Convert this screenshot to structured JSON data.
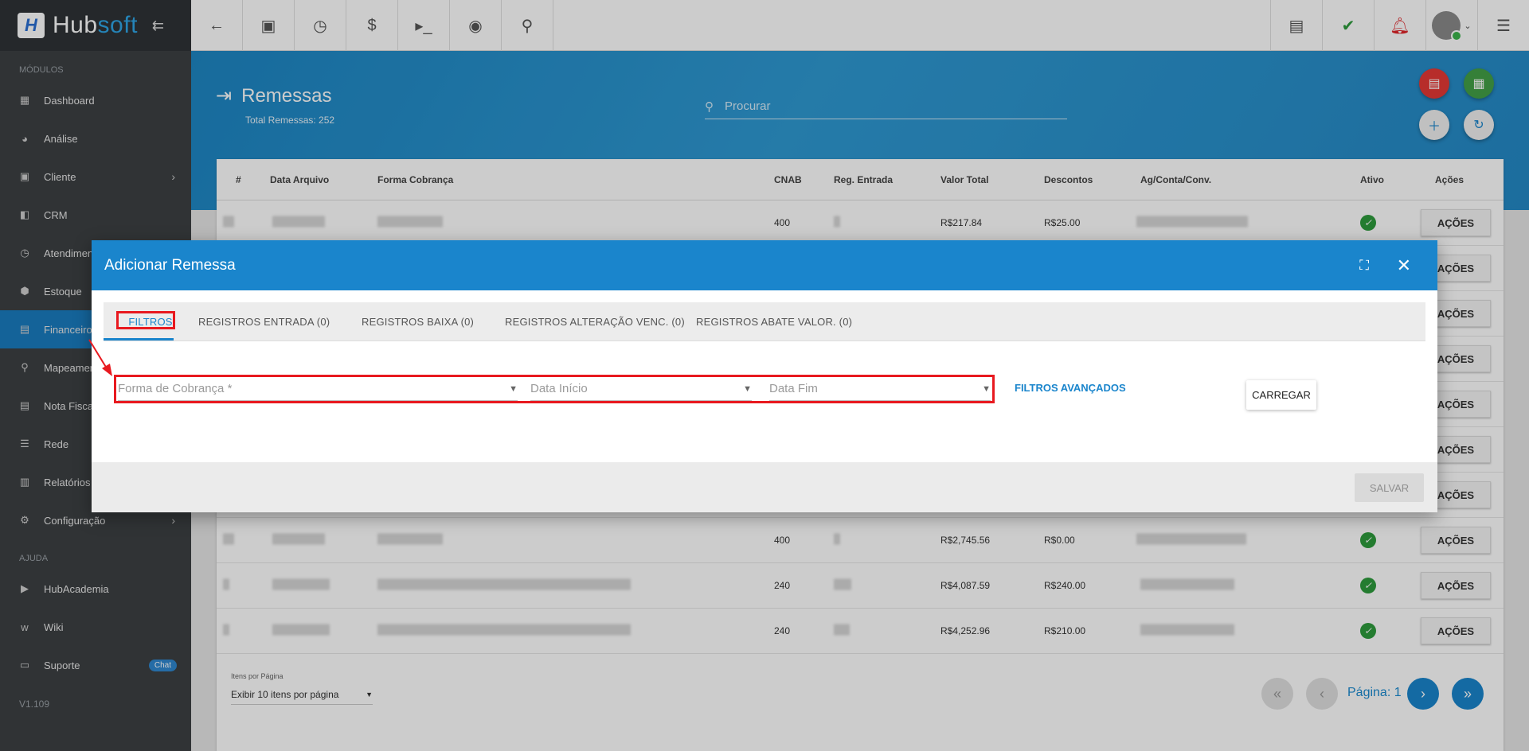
{
  "brand": {
    "hub": "Hub",
    "soft": "soft"
  },
  "sidebar": {
    "section_modules": "MÓDULOS",
    "section_help": "AJUDA",
    "items": [
      {
        "label": "Dashboard",
        "icon": "dashboard-icon"
      },
      {
        "label": "Análise",
        "icon": "pie-chart-icon"
      },
      {
        "label": "Cliente",
        "icon": "contact-card-icon",
        "has_children": true
      },
      {
        "label": "CRM",
        "icon": "crm-icon"
      },
      {
        "label": "Atendimentos",
        "icon": "clock-icon"
      },
      {
        "label": "Estoque",
        "icon": "box-icon"
      },
      {
        "label": "Financeiro",
        "icon": "money-icon",
        "active": true
      },
      {
        "label": "Mapeamento",
        "icon": "map-pin-icon"
      },
      {
        "label": "Nota Fiscal",
        "icon": "invoice-icon"
      },
      {
        "label": "Rede",
        "icon": "network-icon"
      },
      {
        "label": "Relatórios",
        "icon": "report-icon"
      },
      {
        "label": "Configuração",
        "icon": "gear-icon",
        "has_children": true
      }
    ],
    "help_items": [
      {
        "label": "HubAcademia",
        "icon": "play-icon"
      },
      {
        "label": "Wiki",
        "icon": "wiki-icon"
      },
      {
        "label": "Suporte",
        "icon": "chat-icon",
        "badge": "Chat"
      }
    ],
    "version": "V1.109"
  },
  "topbar": {
    "left_icons": [
      "back-arrow-icon",
      "contact-icon",
      "calendar-clock-icon",
      "dollar-icon",
      "terminal-icon",
      "eye-icon",
      "search-icon"
    ],
    "right_icons": [
      "pdf-icon",
      "green-check-message-icon",
      "red-bell-icon",
      "avatar",
      "menu-list-icon"
    ]
  },
  "page": {
    "title": "Remessas",
    "subtitle": "Total Remessas: 252",
    "search_placeholder": "Procurar"
  },
  "table": {
    "columns": [
      "#",
      "Data Arquivo",
      "Forma Cobrança",
      "CNAB",
      "Reg. Entrada",
      "Valor Total",
      "Descontos",
      "Ag/Conta/Conv.",
      "Ativo",
      "Ações"
    ],
    "rows": [
      {
        "cnab": "400",
        "valor": "R$217.84",
        "descontos": "R$25.00",
        "ativo": true,
        "acoes": "AÇÕES"
      },
      {
        "cnab": "",
        "valor": "",
        "descontos": "",
        "ativo": true,
        "acoes": "AÇÕES"
      },
      {
        "cnab": "",
        "valor": "",
        "descontos": "",
        "ativo": true,
        "acoes": "AÇÕES"
      },
      {
        "cnab": "",
        "valor": "",
        "descontos": "",
        "ativo": true,
        "acoes": "AÇÕES"
      },
      {
        "cnab": "",
        "valor": "",
        "descontos": "",
        "ativo": true,
        "acoes": "AÇÕES"
      },
      {
        "cnab": "",
        "valor": "",
        "descontos": "",
        "ativo": true,
        "acoes": "AÇÕES"
      },
      {
        "cnab": "",
        "valor": "",
        "descontos": "",
        "ativo": true,
        "acoes": "AÇÕES"
      },
      {
        "cnab": "400",
        "valor": "R$2,745.56",
        "descontos": "R$0.00",
        "ativo": true,
        "acoes": "AÇÕES"
      },
      {
        "cnab": "240",
        "valor": "R$4,087.59",
        "descontos": "R$240.00",
        "ativo": true,
        "acoes": "AÇÕES"
      },
      {
        "cnab": "240",
        "valor": "R$4,252.96",
        "descontos": "R$210.00",
        "ativo": true,
        "acoes": "AÇÕES"
      }
    ]
  },
  "pagination": {
    "per_page_label": "Itens por Página",
    "per_page_value": "Exibir 10 itens por página",
    "page_label": "Página: 1"
  },
  "modal": {
    "title": "Adicionar Remessa",
    "tabs": [
      "FILTROS",
      "REGISTROS ENTRADA (0)",
      "REGISTROS BAIXA (0)",
      "REGISTROS ALTERAÇÃO VENC. (0)",
      "REGISTROS ABATE VALOR. (0)"
    ],
    "fields": {
      "forma_cobranca": "Forma de Cobrança *",
      "data_inicio": "Data Início",
      "data_fim": "Data Fim"
    },
    "advanced_filters": "FILTROS AVANÇADOS",
    "load_button": "CARREGAR",
    "save_button": "SALVAR"
  },
  "colors": {
    "primary": "#1a85cc",
    "sidebar_bg": "#3c4043",
    "highlight": "#e8191f",
    "active_green": "#2e9b3c"
  }
}
